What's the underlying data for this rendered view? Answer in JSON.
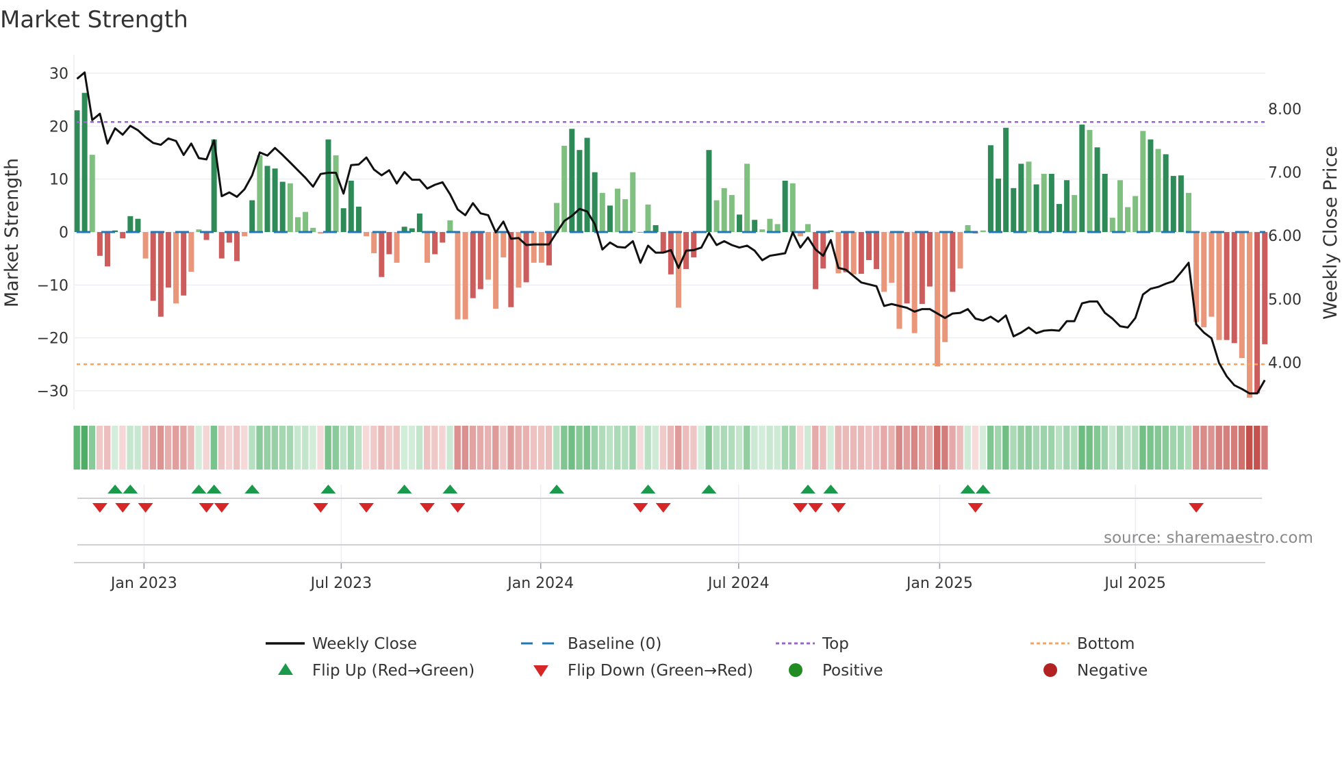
{
  "chart_data": {
    "type": "bar",
    "title": "Market Strength",
    "ylabel": "Market Strength",
    "y2label": "Weekly Close Price",
    "ylim": [
      -33.5,
      33.5
    ],
    "y2lim": [
      3.26,
      8.85
    ],
    "yticks": [
      30,
      20,
      10,
      0,
      -10,
      -20,
      -30
    ],
    "yticklabels": [
      "30",
      "20",
      "10",
      "0",
      "−10",
      "−20",
      "−30"
    ],
    "y2ticks": [
      8,
      7,
      6,
      5,
      4
    ],
    "y2ticklabels": [
      "8.00",
      "7.00",
      "6.00",
      "5.00",
      "4.00"
    ],
    "xticks": [
      {
        "week": 8.8,
        "label": "Jan 2023"
      },
      {
        "week": 34.7,
        "label": "Jul 2023"
      },
      {
        "week": 60.9,
        "label": "Jan 2024"
      },
      {
        "week": 86.9,
        "label": "Jul 2024"
      },
      {
        "week": 113.3,
        "label": "Jan 2025"
      },
      {
        "week": 139,
        "label": "Jul 2025"
      }
    ],
    "top_level": 20.8,
    "bottom_level": -25,
    "baseline": 0,
    "strength": [
      23,
      26.3,
      14.6,
      -4.5,
      -6.5,
      0.3,
      -1.2,
      3,
      2.5,
      -5,
      -13,
      -16,
      -10.5,
      -13.5,
      -12,
      -7.5,
      0.5,
      -1.5,
      17.5,
      -5,
      -2,
      -5.5,
      -0.8,
      6,
      14.5,
      12.5,
      12,
      9.5,
      9.2,
      2.8,
      3.8,
      0.8,
      -0.3,
      17.5,
      14.5,
      4.5,
      9.7,
      4.8,
      -0.8,
      -4,
      -8.5,
      -4.2,
      -5.8,
      1,
      0.7,
      3.5,
      -5.8,
      -4.2,
      -2,
      2.2,
      -16.5,
      -16.5,
      -12.5,
      -10.8,
      -9,
      -14.5,
      -4.8,
      -14.2,
      -10.5,
      -9.5,
      -5.8,
      -5.8,
      -6.3,
      5.5,
      16.3,
      19.5,
      15.5,
      17.8,
      11.3,
      7.4,
      5,
      8.2,
      6.2,
      11.3,
      -0.1,
      5.2,
      1.3,
      -4,
      -8,
      -14.3,
      -7,
      -4.8,
      0,
      15.5,
      6,
      8.3,
      7,
      3.3,
      12.9,
      2.3,
      0.5,
      2.5,
      1.5,
      9.7,
      9.2,
      -0.8,
      1.5,
      -10.8,
      -6.9,
      0.3,
      -7.8,
      -7.6,
      -8,
      -7.9,
      -5.3,
      -7,
      -11.3,
      -9.6,
      -18.3,
      -13.5,
      -19.1,
      -13.6,
      -10.3,
      -25.4,
      -20.8,
      -11.3,
      -6.9,
      1.3,
      -0.3,
      0.3,
      16.4,
      10.1,
      19.7,
      8.3,
      12.9,
      13.3,
      9,
      11,
      11,
      5.3,
      9.8,
      7,
      20.3,
      19.3,
      16,
      11,
      2.7,
      9.8,
      4.7,
      6.8,
      19.1,
      17.5,
      15.7,
      14.7,
      10.6,
      10.7,
      7.4,
      -17,
      -18,
      -16,
      -20.4,
      -20.4,
      -21,
      -23.8,
      -31.3,
      -30.5,
      -21.2
    ],
    "shade": "ddlddddddldddldlldddddldldddllllldldddllddldddlddlllddllldldlldllddddldllldldddlddddllldldllldllldddldldddllldlddlldlllldddddldldddldlddllllldldddlllllddllddldlddld",
    "weekly_close": [
      8.47,
      8.57,
      7.82,
      7.92,
      7.45,
      7.69,
      7.59,
      7.73,
      7.66,
      7.55,
      7.46,
      7.43,
      7.53,
      7.49,
      7.27,
      7.45,
      7.22,
      7.2,
      7.5,
      6.62,
      6.68,
      6.61,
      6.73,
      6.95,
      7.31,
      7.26,
      7.38,
      7.27,
      7.15,
      7.03,
      6.91,
      6.77,
      6.97,
      6.99,
      6.99,
      6.66,
      7.11,
      7.12,
      7.23,
      7.04,
      6.95,
      7.03,
      6.82,
      7.0,
      6.88,
      6.88,
      6.74,
      6.8,
      6.84,
      6.65,
      6.41,
      6.32,
      6.51,
      6.35,
      6.32,
      6.05,
      6.22,
      5.95,
      5.96,
      5.85,
      5.86,
      5.86,
      5.86,
      6.05,
      6.23,
      6.31,
      6.42,
      6.38,
      6.18,
      5.78,
      5.89,
      5.82,
      5.81,
      5.91,
      5.57,
      5.84,
      5.73,
      5.73,
      5.77,
      5.49,
      5.76,
      5.77,
      5.81,
      6.04,
      5.85,
      5.91,
      5.85,
      5.81,
      5.84,
      5.76,
      5.61,
      5.68,
      5.7,
      5.72,
      6.05,
      5.81,
      5.97,
      5.78,
      5.68,
      5.93,
      5.49,
      5.46,
      5.36,
      5.26,
      5.23,
      5.2,
      4.89,
      4.92,
      4.89,
      4.86,
      4.8,
      4.84,
      4.84,
      4.77,
      4.7,
      4.77,
      4.78,
      4.84,
      4.69,
      4.66,
      4.72,
      4.64,
      4.74,
      4.41,
      4.47,
      4.55,
      4.46,
      4.5,
      4.51,
      4.5,
      4.65,
      4.65,
      4.93,
      4.96,
      4.96,
      4.78,
      4.69,
      4.57,
      4.55,
      4.7,
      5.07,
      5.16,
      5.19,
      5.24,
      5.28,
      5.42,
      5.57,
      4.6,
      4.47,
      4.38,
      3.99,
      3.78,
      3.64,
      3.58,
      3.51,
      3.51,
      3.72
    ],
    "flip_up_weeks": [
      5,
      7,
      16,
      18,
      23,
      33,
      43,
      49,
      63,
      75,
      83,
      96,
      99,
      117,
      119
    ],
    "flip_down_weeks": [
      3,
      6,
      9,
      17,
      19,
      32,
      38,
      46,
      50,
      74,
      77,
      95,
      97,
      100,
      118,
      147
    ],
    "colors": {
      "green_strong": "#2e8b57",
      "green_weak": "#7fc080",
      "red_strong": "#cd5c5c",
      "red_weak": "#e9967a",
      "baseline": "#1f77b4",
      "top": "#9966cc",
      "bottom": "#f4a460",
      "flip_up": "#1a9a4a",
      "flip_down": "#d62728",
      "positive": "#228b22",
      "negative": "#b22222",
      "close": "#111111"
    },
    "legend": [
      {
        "key": "close",
        "label": "Weekly Close"
      },
      {
        "key": "baseline",
        "label": "Baseline (0)"
      },
      {
        "key": "top",
        "label": "Top"
      },
      {
        "key": "bottom",
        "label": "Bottom"
      },
      {
        "key": "flip_up",
        "label": "Flip Up (Red→Green)"
      },
      {
        "key": "flip_down",
        "label": "Flip Down (Green→Red)"
      },
      {
        "key": "positive",
        "label": "Positive"
      },
      {
        "key": "negative",
        "label": "Negative"
      }
    ],
    "source": "source: sharemaestro.com"
  }
}
